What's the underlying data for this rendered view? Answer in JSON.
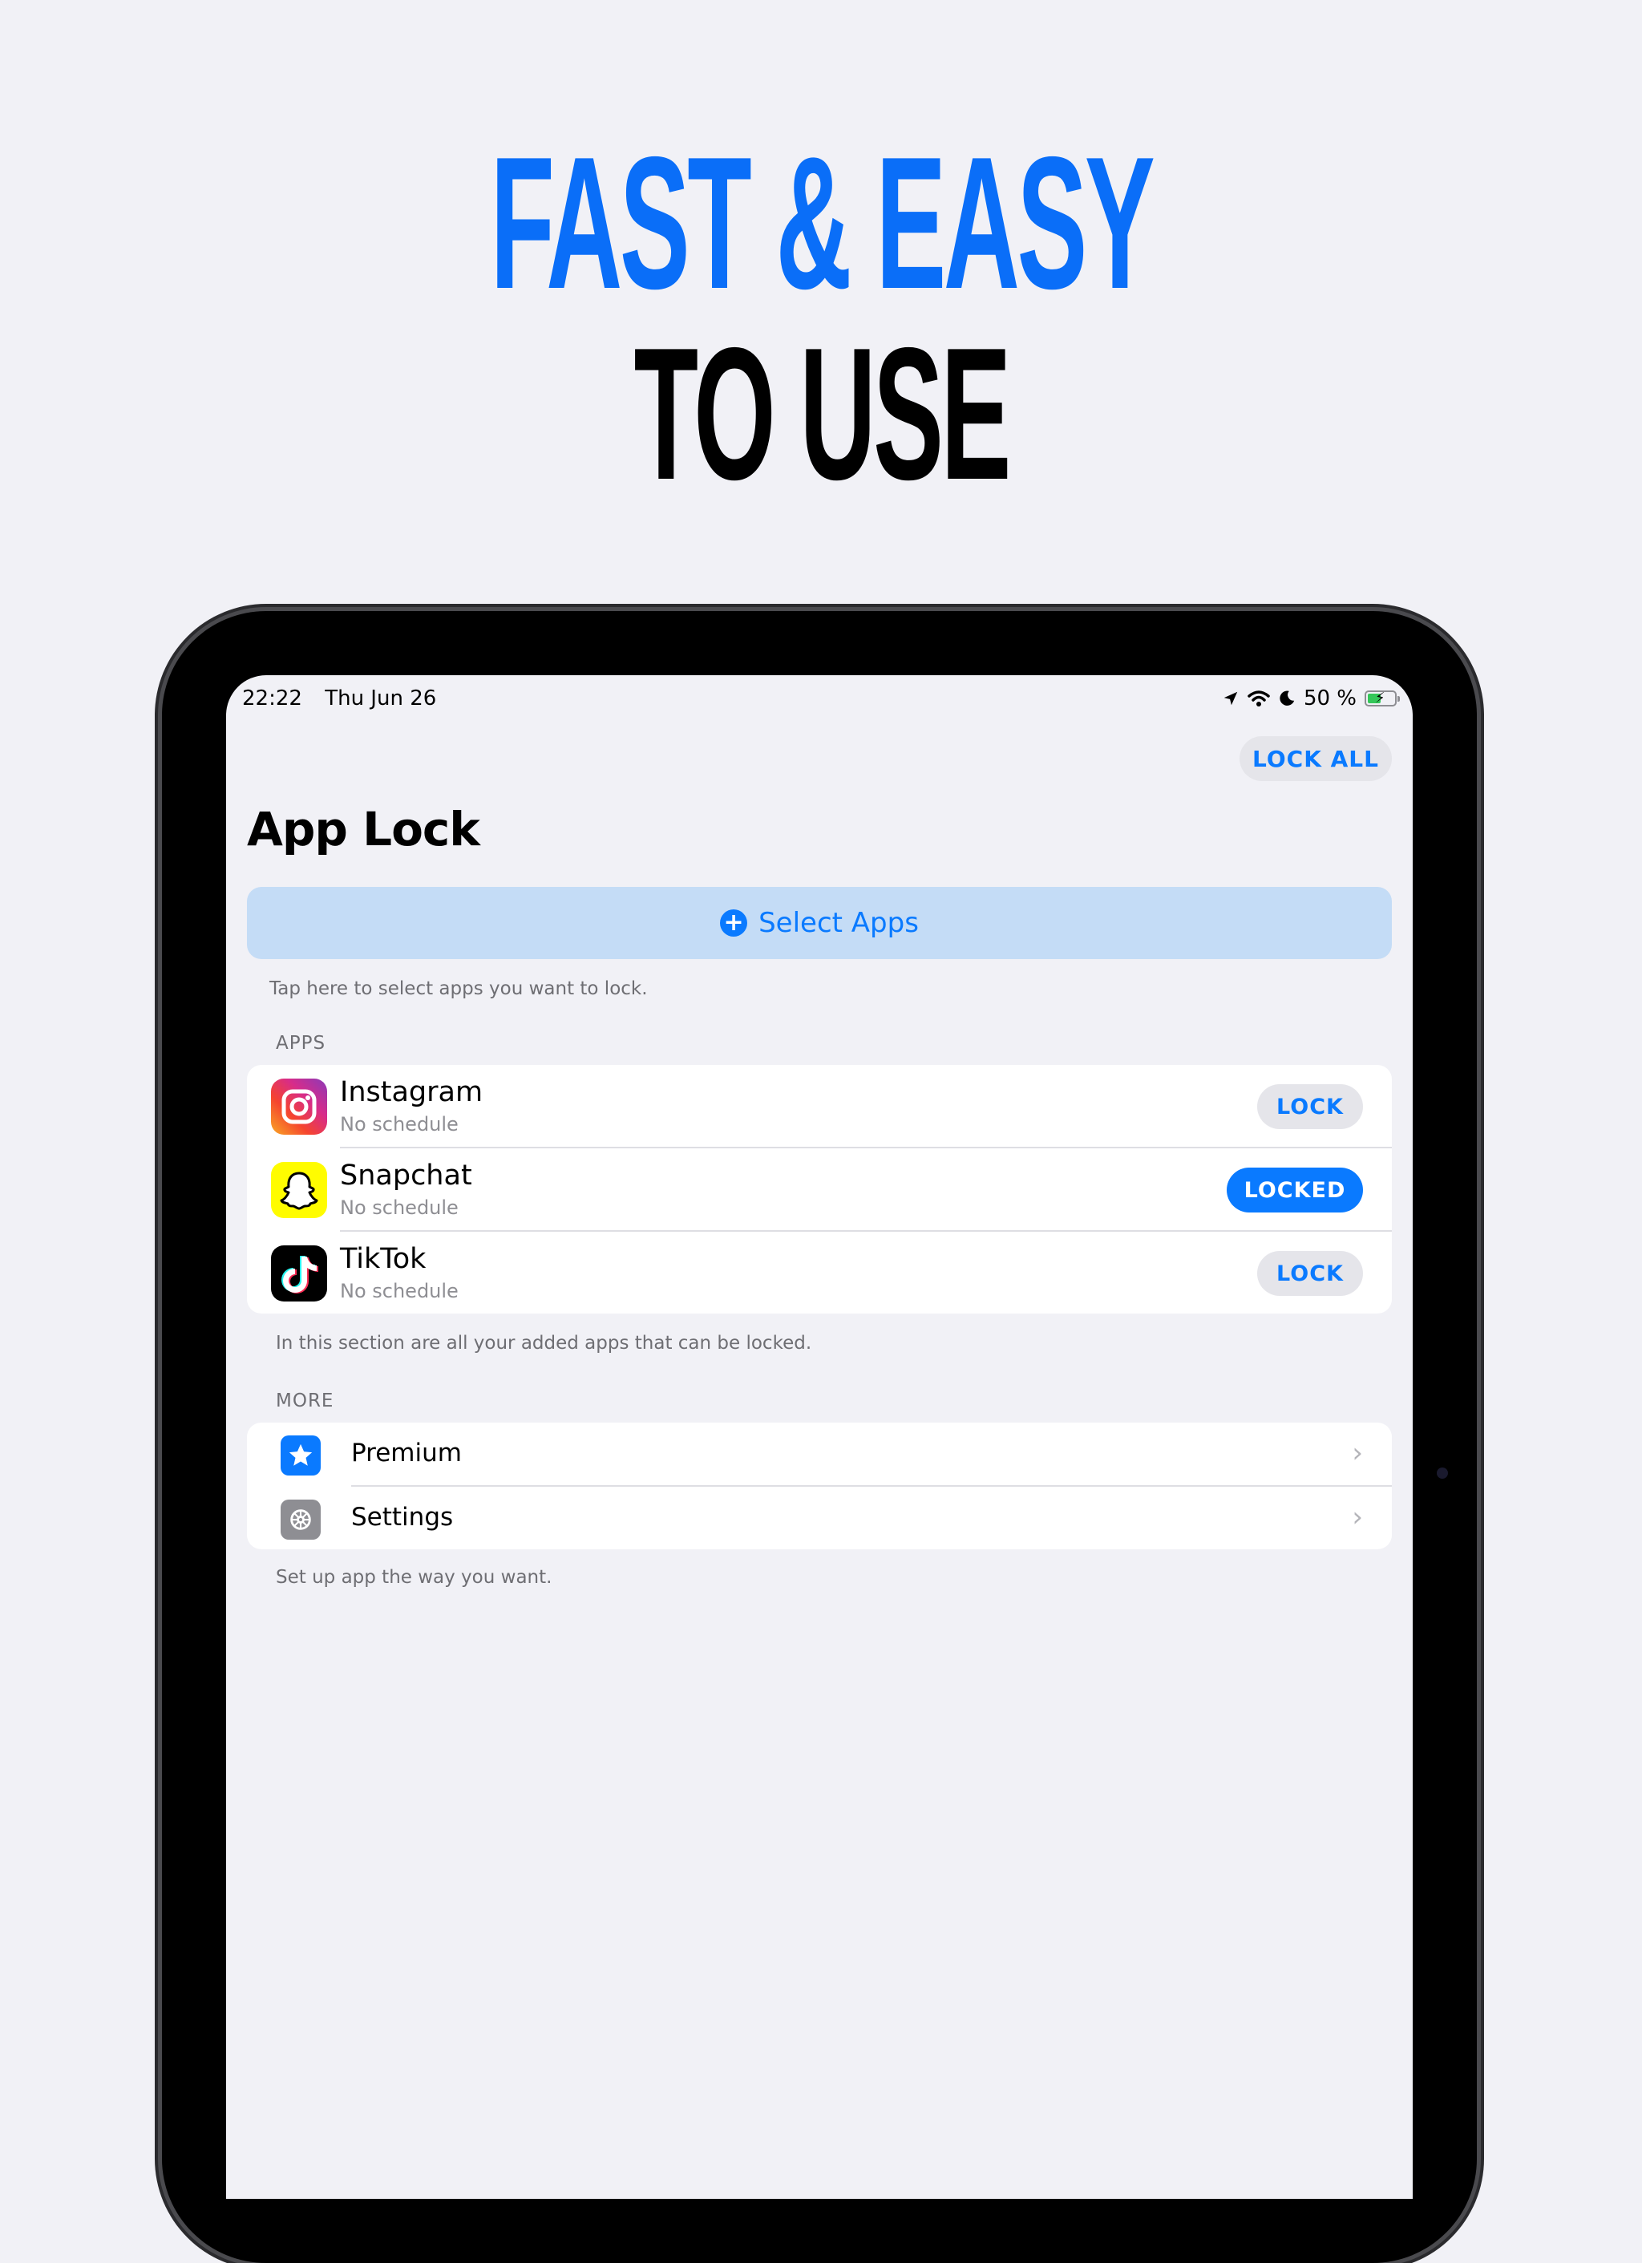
{
  "headline": {
    "line1": "FAST & EASY",
    "line2": "TO USE"
  },
  "status_bar": {
    "time": "22:22",
    "date": "Thu Jun 26",
    "battery": "50 %",
    "battery_level": 0.5
  },
  "toolbar": {
    "lock_all_label": "LOCK ALL"
  },
  "page": {
    "title": "App Lock"
  },
  "select_apps": {
    "label": "Select Apps",
    "hint": "Tap here to select apps you want to lock."
  },
  "apps_section": {
    "header": "APPS",
    "footer": "In this section are all your added apps that can be locked.",
    "items": [
      {
        "name": "Instagram",
        "schedule": "No schedule",
        "button": "LOCK",
        "locked": false,
        "icon": "instagram-icon"
      },
      {
        "name": "Snapchat",
        "schedule": "No schedule",
        "button": "LOCKED",
        "locked": true,
        "icon": "snapchat-icon"
      },
      {
        "name": "TikTok",
        "schedule": "No schedule",
        "button": "LOCK",
        "locked": false,
        "icon": "tiktok-icon"
      }
    ]
  },
  "more_section": {
    "header": "MORE",
    "footer": "Set up app the way you want.",
    "items": [
      {
        "label": "Premium",
        "icon": "star-icon"
      },
      {
        "label": "Settings",
        "icon": "gear-icon"
      }
    ]
  },
  "colors": {
    "accent": "#0a7aff",
    "headline_blue": "#0a6ef8",
    "background": "#f1f1f6",
    "select_apps_bg": "#c4dcf6"
  }
}
